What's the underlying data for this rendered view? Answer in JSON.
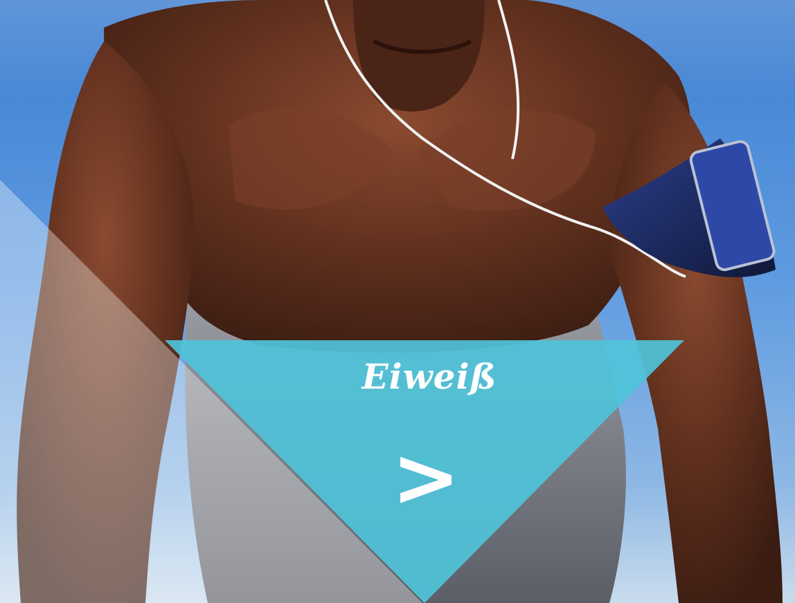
{
  "banner": {
    "title": "Eiweiß",
    "arrow_label": ">"
  },
  "colors": {
    "accent": "#4fc3d9",
    "sky": "#5b93d2",
    "skin": "#5a2e1e",
    "text": "#ffffff"
  },
  "icons": {
    "arrow": "chevron-right-icon"
  }
}
